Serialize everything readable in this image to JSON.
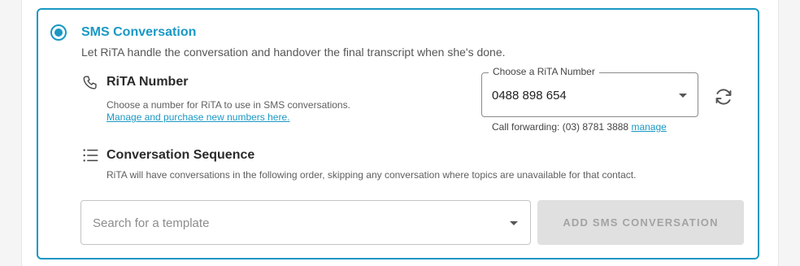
{
  "sms_option": {
    "title": "SMS Conversation",
    "description": "Let RiTA handle the conversation and handover the final transcript when she's done.",
    "selected": true
  },
  "rita_number": {
    "icon": "phone-icon",
    "title": "RiTA Number",
    "description": "Choose a number for RiTA to use in SMS conversations.",
    "manage_link": "Manage and purchase new numbers here.",
    "select_label": "Choose a RiTA Number",
    "select_value": "0488 898 654",
    "forwarding_text": "Call forwarding: (03) 8781 3888",
    "forwarding_link": "manage",
    "refresh_icon": "refresh-icon"
  },
  "sequence": {
    "icon": "list-icon",
    "title": "Conversation Sequence",
    "description": "RiTA will have conversations in the following order, skipping any conversation where topics are unavailable for that contact."
  },
  "template_search": {
    "placeholder": "Search for a template",
    "add_button_label": "ADD SMS CONVERSATION",
    "add_button_disabled": true
  },
  "colors": {
    "accent": "#1a98c4",
    "disabled_bg": "#e0e0e0",
    "disabled_text": "#a3a3a3"
  }
}
